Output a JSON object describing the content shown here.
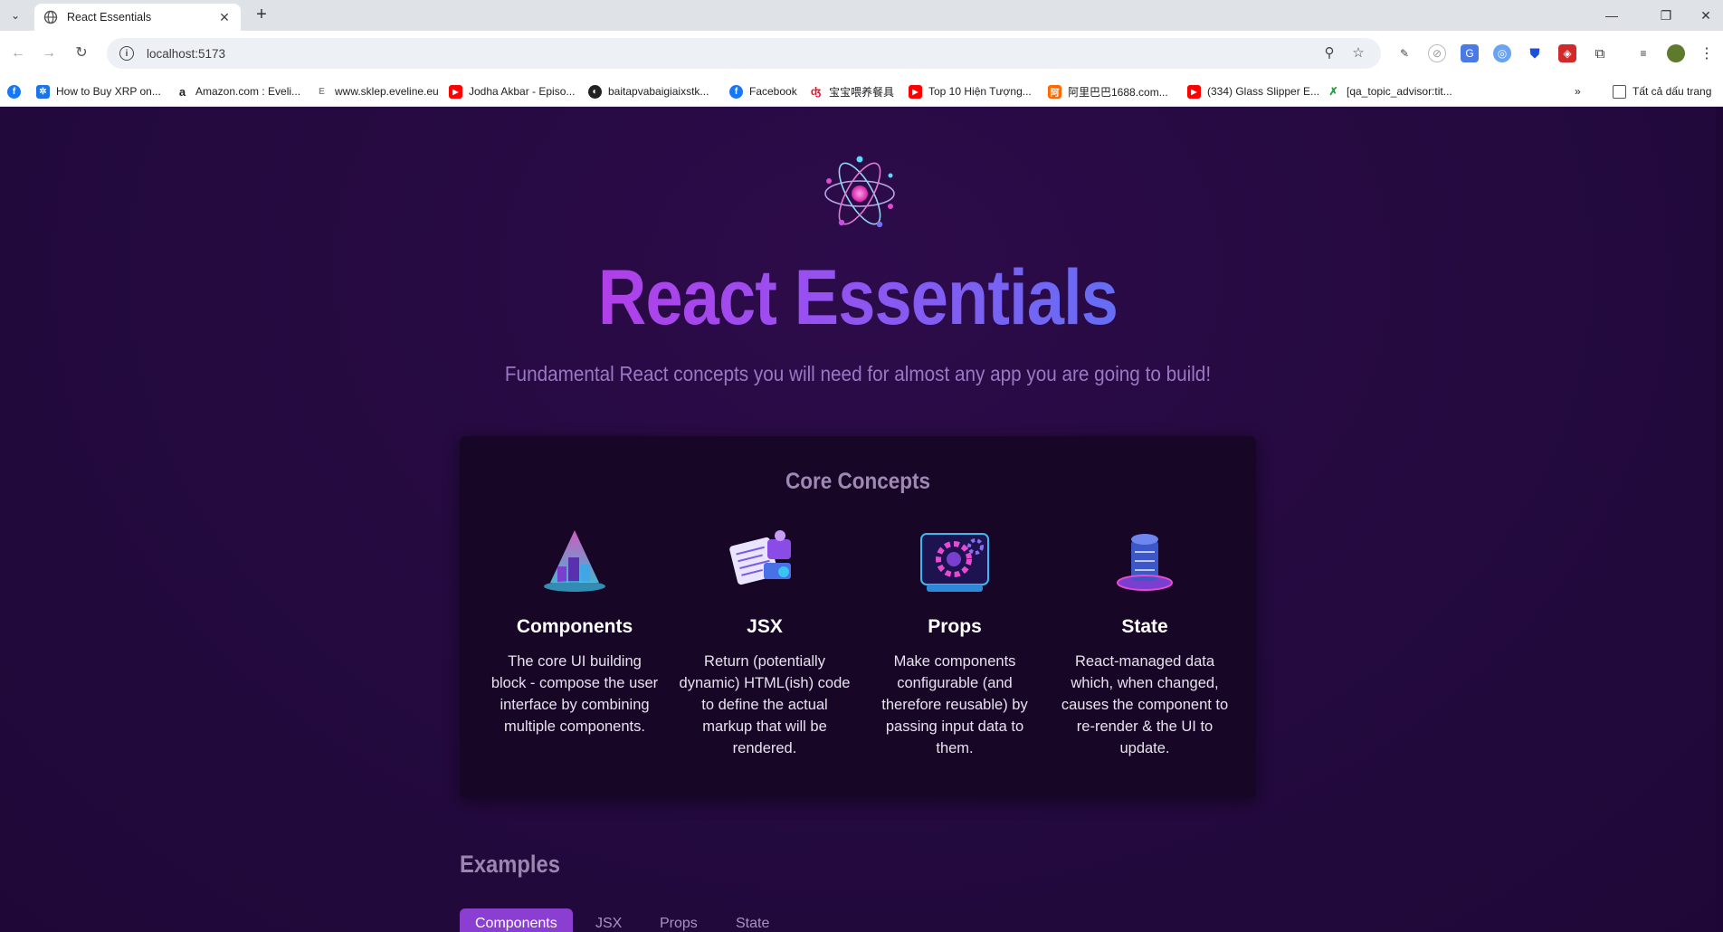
{
  "browser": {
    "tab": {
      "title": "React Essentials"
    },
    "address": {
      "url": "localhost:5173"
    },
    "bookmarks": [
      {
        "label": "How to Buy XRP on...",
        "icon": "network-icon",
        "color": "#1a73e8"
      },
      {
        "label": "Amazon.com : Eveli...",
        "icon": "amazon-icon",
        "color": "#222222"
      },
      {
        "label": "www.sklep.eveline.eu",
        "icon": "eveline-icon",
        "color": "#999999"
      },
      {
        "label": "Jodha Akbar - Episo...",
        "icon": "youtube-icon",
        "color": "#ff0000"
      },
      {
        "label": "baitapvabaigiaixstk...",
        "icon": "globe-icon",
        "color": "#222222"
      },
      {
        "label": "Facebook",
        "icon": "facebook-icon",
        "color": "#1877f2"
      },
      {
        "label": "宝宝喂养餐具",
        "icon": "weibo-icon",
        "color": "#e6162d"
      },
      {
        "label": "Top 10 Hiện Tượng...",
        "icon": "youtube-icon",
        "color": "#ff0000"
      },
      {
        "label": "阿里巴巴1688.com...",
        "icon": "alibaba-icon",
        "color": "#ff6a00"
      },
      {
        "label": "(334) Glass Slipper E...",
        "icon": "youtube-icon",
        "color": "#ff0000"
      },
      {
        "label": "[qa_topic_advisor:tit...",
        "icon": "x-icon",
        "color": "#2e9b48"
      }
    ],
    "all_bookmarks_label": "Tất cả dấu trang"
  },
  "page": {
    "title": "React Essentials",
    "tagline": "Fundamental React concepts you will need for almost any app you are going to build!",
    "core_title": "Core Concepts",
    "concepts": [
      {
        "title": "Components",
        "description": "The core UI building block - compose the user interface by combining multiple components."
      },
      {
        "title": "JSX",
        "description": "Return (potentially dynamic) HTML(ish) code to define the actual markup that will be rendered."
      },
      {
        "title": "Props",
        "description": "Make components configurable (and therefore reusable) by passing input data to them."
      },
      {
        "title": "State",
        "description": "React-managed data which, when changed, causes the component to re-render & the UI to update."
      }
    ],
    "examples_title": "Examples",
    "example_tabs": [
      "Components",
      "JSX",
      "Props",
      "State"
    ],
    "active_tab": "Components"
  }
}
